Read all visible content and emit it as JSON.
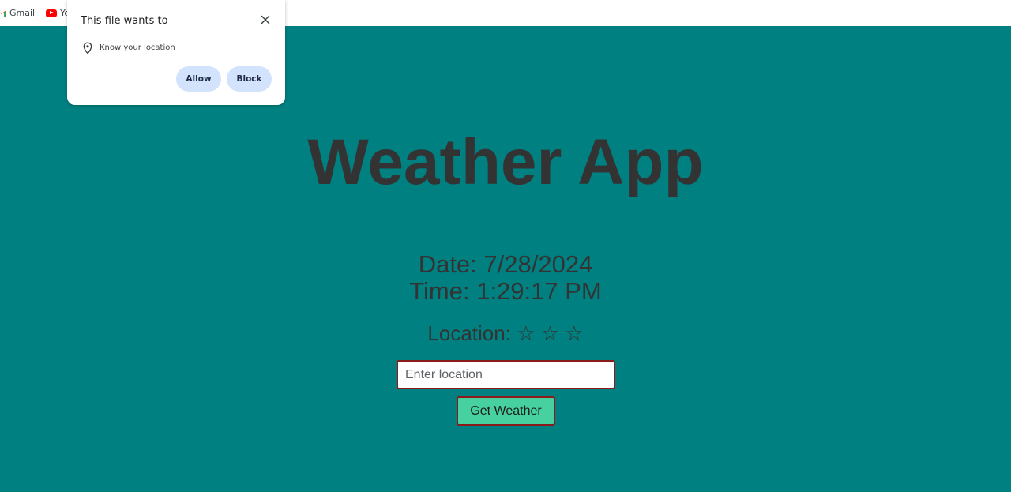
{
  "bookmarks": [
    {
      "label": "Gmail",
      "icon": "gmail-icon"
    },
    {
      "label": "You",
      "icon": "youtube-icon"
    }
  ],
  "popup": {
    "title": "This file wants to",
    "permission": "Know your location",
    "allow_label": "Allow",
    "block_label": "Block",
    "close_icon": "close-icon",
    "permission_icon": "location-pin-icon"
  },
  "app": {
    "title": "Weather App",
    "date_text": "Date: 7/28/2024",
    "time_text": "Time: 1:29:17 PM",
    "location_label": "Location:",
    "location_value": "☆ ☆ ☆",
    "input_placeholder": "Enter location",
    "input_value": "",
    "button_label": "Get Weather"
  },
  "colors": {
    "background": "#008080",
    "text": "#333333",
    "button": "#48d1a0",
    "button_border": "#8b1a1a",
    "popup_button": "#d3e3fd"
  }
}
